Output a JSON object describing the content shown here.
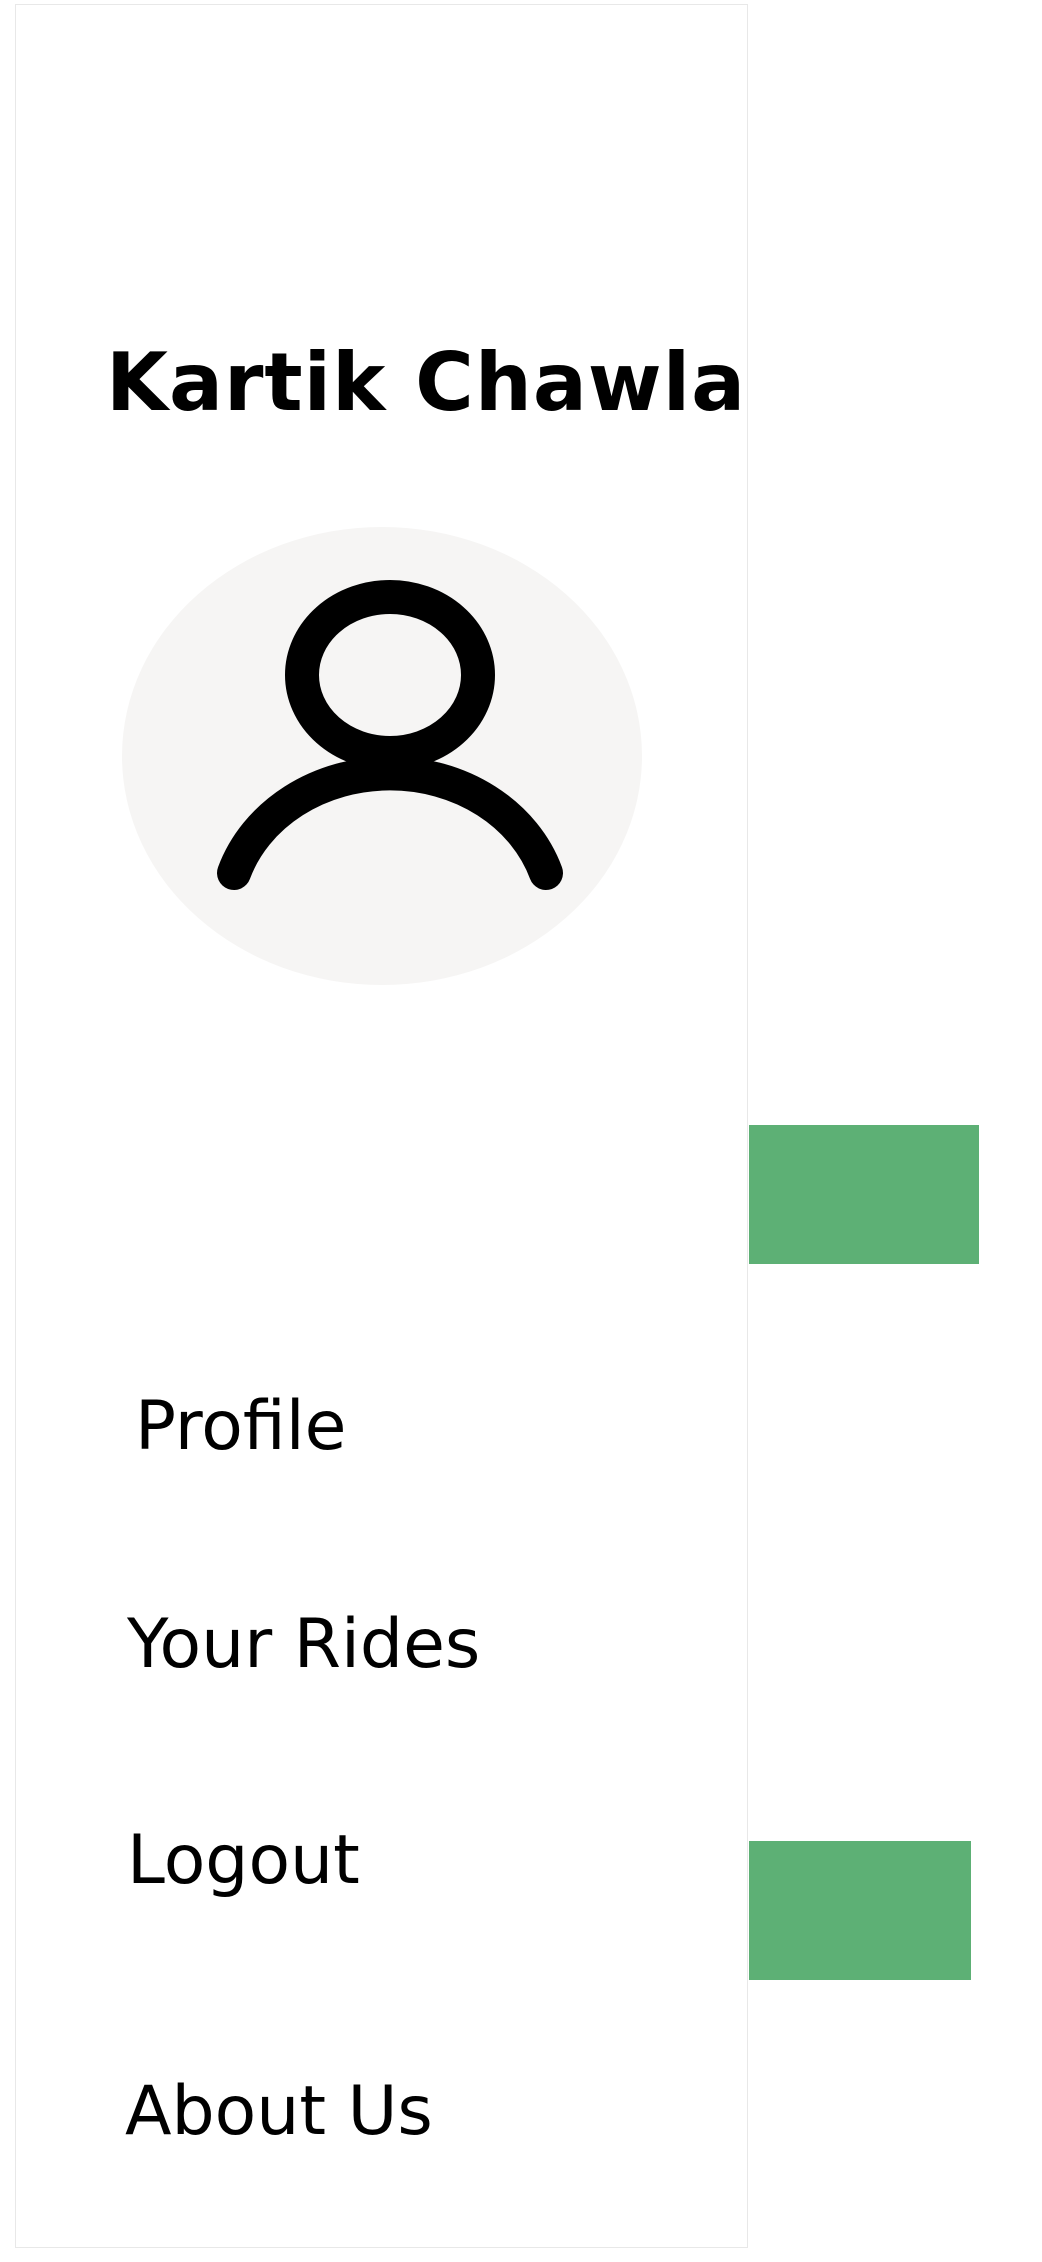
{
  "drawer": {
    "user_name": "Kartik Chawla",
    "avatar_icon": "user-icon",
    "menu_items": [
      {
        "label": "Profile"
      },
      {
        "label": "Your Rides"
      },
      {
        "label": "Logout"
      },
      {
        "label": "About Us"
      }
    ]
  },
  "colors": {
    "accent_green": "#5db075",
    "avatar_bg": "#f6f5f4"
  }
}
